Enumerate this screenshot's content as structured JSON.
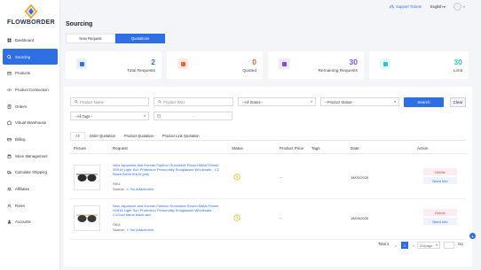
{
  "app": {
    "logo_text": "FLOWBORDER"
  },
  "sidebar": {
    "items": [
      {
        "label": "Dashboard",
        "icon": "dashboard-icon"
      },
      {
        "label": "Sourcing",
        "icon": "search-icon",
        "active": true
      },
      {
        "label": "Products",
        "icon": "box-icon"
      },
      {
        "label": "Product Connection",
        "icon": "link-icon"
      },
      {
        "label": "Orders",
        "icon": "orders-icon"
      },
      {
        "label": "Virtual Warehouse",
        "icon": "warehouse-icon"
      },
      {
        "label": "Billing",
        "icon": "billing-icon"
      },
      {
        "label": "Store Management",
        "icon": "store-icon"
      },
      {
        "label": "Calculate Shipping",
        "icon": "truck-icon"
      },
      {
        "label": "Affiliates",
        "icon": "affiliates-icon"
      },
      {
        "label": "Roles",
        "icon": "roles-icon"
      },
      {
        "label": "Accounts",
        "icon": "account-icon"
      }
    ]
  },
  "header": {
    "support": "Support Tickets",
    "language": "English"
  },
  "page": {
    "title": "Sourcing"
  },
  "top_tabs": {
    "new_request": "New Request",
    "quotations": "Quotations"
  },
  "stats": [
    {
      "value": "2",
      "label": "Total Requests",
      "color": "#2f6fe4",
      "bg": "#e8effd"
    },
    {
      "value": "0",
      "label": "Quoted",
      "color": "#f0643c",
      "bg": "#fdeae4"
    },
    {
      "value": "30",
      "label": "Remaining Requests",
      "color": "#7b4fd6",
      "bg": "#eee8fb"
    },
    {
      "value": "30",
      "label": "Limit",
      "color": "#35c3c6",
      "bg": "#e3f7f7"
    }
  ],
  "filters": {
    "product_name_placeholder": "Product Name",
    "product_sku_placeholder": "Product SKU",
    "status": "--All Status--",
    "product_status": "--Product Status--",
    "tags": "--All Tags--",
    "date_sep": "-",
    "search": "Search",
    "clear": "Clear"
  },
  "sub_tabs": [
    "All",
    "Order Quotation",
    "Product Quotation",
    "Product Link Quotation"
  ],
  "table": {
    "headers": {
      "picture": "Picture",
      "request": "Request",
      "status": "Status",
      "price": "Product Price",
      "tags": "Tags",
      "date": "Date",
      "action": "Action"
    },
    "rows": [
      {
        "title": "New Japanese and Korean Fashion Sunshade Round Metal Frame S0918 Light Sun Protection Personality Sunglasses Wholesale - C2 Black frame tea to gray",
        "sku": "SKU:",
        "source_label": "Source:",
        "attachment": "No Attachment",
        "price": "--",
        "date": "18/03/2025",
        "delete": "Delete",
        "need_info": "Need Info"
      },
      {
        "title": "New Japanese and Korean Fashion Sunshade Round Metal Frame S0918 Light Sun Protection Personality Sunglasses Wholesale - C1Gold frame black ash",
        "sku": "SKU:",
        "source_label": "Source:",
        "attachment": "No Attachment",
        "price": "--",
        "date": "18/03/2025",
        "delete": "Delete",
        "need_info": "Need Info"
      }
    ]
  },
  "pagination": {
    "total": "Total 2",
    "prev": "<",
    "page": "1",
    "next": ">",
    "page_size": "20/page",
    "go": "Go"
  }
}
